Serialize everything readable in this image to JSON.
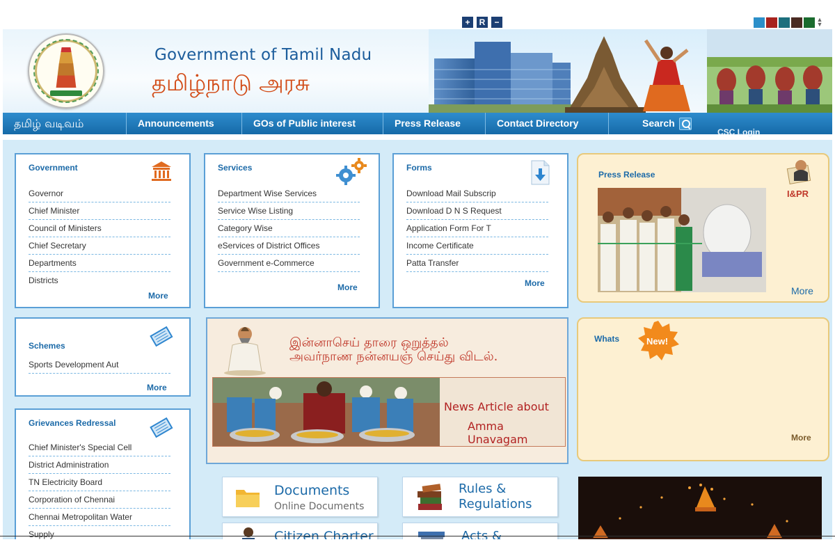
{
  "font_controls": [
    "+",
    "R",
    "−"
  ],
  "theme_colors": [
    "#2c8fc9",
    "#a8231e",
    "#1d6f7d",
    "#4a2b22",
    "#1a6b2e"
  ],
  "header": {
    "title_en": "Government of Tamil Nadu",
    "title_ta": "தமிழ்நாடு அரசு"
  },
  "nav": {
    "tamil": "தமிழ் வடிவம்",
    "items": [
      "Announcements",
      "GOs of Public interest",
      "Press Release",
      "Contact Directory"
    ],
    "search": "Search",
    "csc_login": "CSC Login"
  },
  "government": {
    "title": "Government",
    "items": [
      "Governor",
      "Chief Minister",
      "Council of Ministers",
      "Chief Secretary",
      "Departments",
      "Districts"
    ],
    "more": "More"
  },
  "services": {
    "title": "Services",
    "items": [
      "Department Wise Services",
      "Service Wise Listing",
      "Category Wise",
      "eServices of District Offices",
      "Government e-Commerce"
    ],
    "more": "More"
  },
  "forms": {
    "title": "Forms",
    "items": [
      "Download Mail Subscrip",
      "Download D N S Request",
      "Application Form For T",
      "Income Certificate",
      "Patta Transfer"
    ],
    "more": "More"
  },
  "press": {
    "title": "Press Release",
    "logo_text": "I&PR",
    "more": "More"
  },
  "schemes": {
    "title": "Schemes",
    "items": [
      "Sports Development Aut"
    ],
    "more": "More"
  },
  "grievances": {
    "title": "Grievances Redressal",
    "items": [
      "Chief Minister's Special Cell",
      "District Administration",
      "TN Electricity Board",
      "Corporation of Chennai",
      "Chennai Metropolitan Water",
      "Supply"
    ]
  },
  "feature": {
    "kural_line1": "இன்னாசெய் தாரை ஒறுத்தல்",
    "kural_line2": "அவர்நாண நன்னயஞ் செய்து விடல்.",
    "news_line1": "News Article about",
    "news_line2": "Amma Unavagam"
  },
  "whats": {
    "title": "Whats",
    "badge": "New!",
    "more": "More"
  },
  "tiles": {
    "documents": {
      "title": "Documents",
      "sub": "Online Documents"
    },
    "rules": {
      "line1": "Rules &",
      "line2": "Regulations"
    },
    "citizen": {
      "title": "Citizen Charter"
    },
    "acts": {
      "title": "Acts &"
    }
  }
}
